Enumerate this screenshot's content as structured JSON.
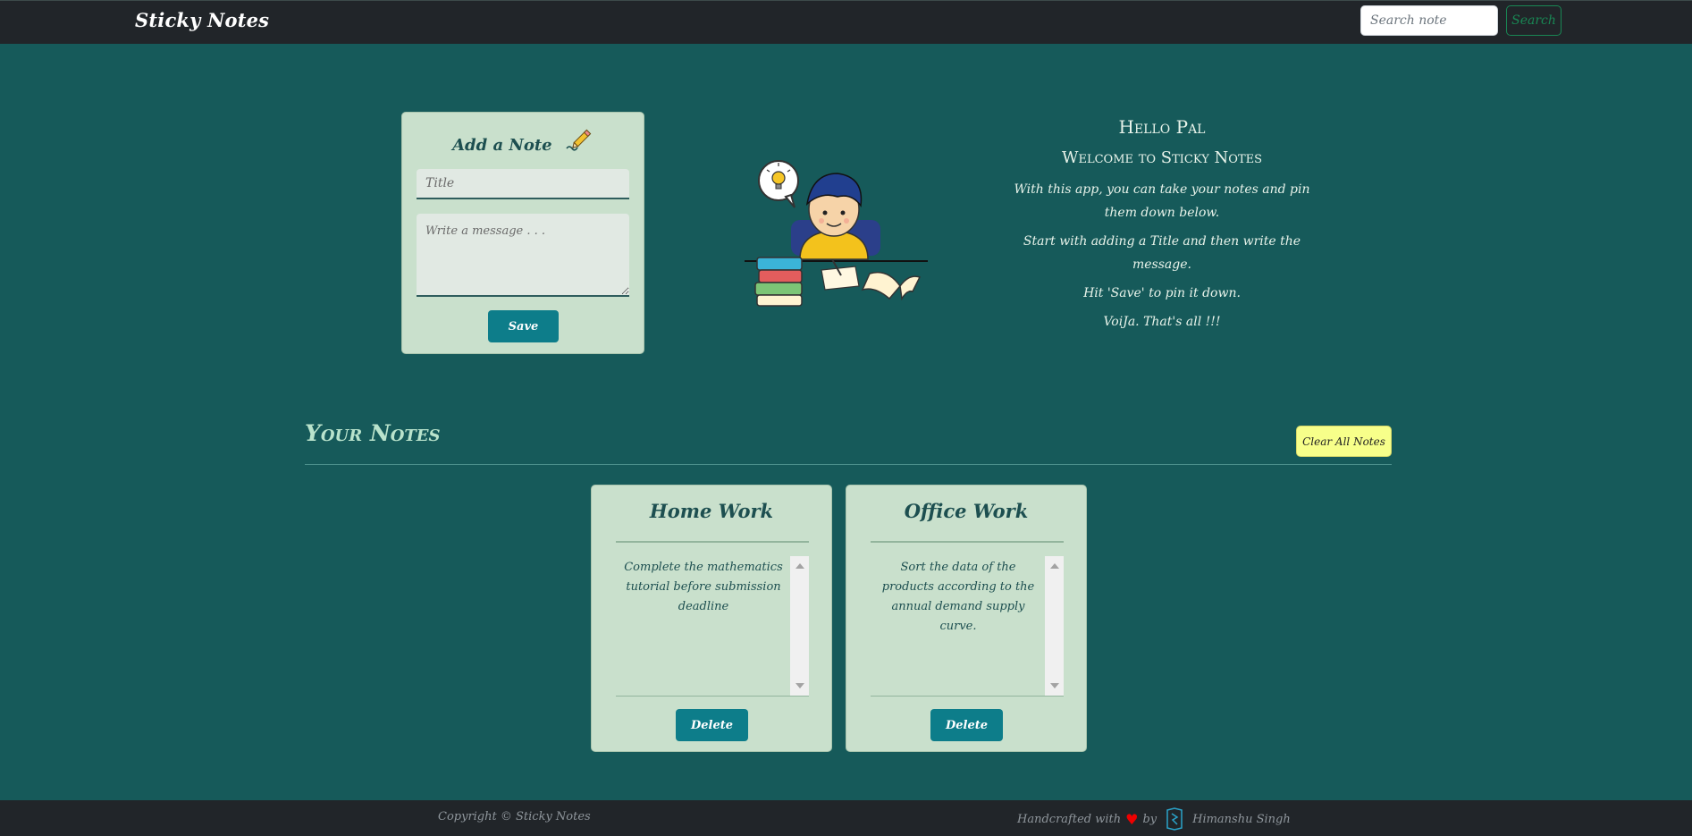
{
  "navbar": {
    "brand": "Sticky Notes",
    "search_placeholder": "Search note",
    "search_button": "Search"
  },
  "add_note": {
    "heading": "Add a Note",
    "title_placeholder": "Title",
    "message_placeholder": "Write a message . . .",
    "save_button": "Save"
  },
  "welcome": {
    "hello": "Hello Pal",
    "subtitle": "Welcome to Sticky Notes",
    "lines": [
      "With this app, you can take your notes and pin them down below.",
      "Start with adding a Title and then write the message.",
      "Hit 'Save' to pin it down.",
      "VoiJa. That's all !!!"
    ]
  },
  "notes_section": {
    "heading": "Your Notes",
    "clear_button": "Clear All Notes",
    "notes": [
      {
        "title": "Home Work",
        "text": "Complete the mathematics tutorial before submission deadline",
        "delete_label": "Delete"
      },
      {
        "title": "Office Work",
        "text": "Sort the data of the products according to the annual demand supply curve.",
        "delete_label": "Delete"
      }
    ]
  },
  "footer": {
    "copyright": "Copyright © Sticky Notes",
    "credit_prefix": "Handcrafted with",
    "credit_by": "by",
    "author": "Himanshu Singh"
  },
  "colors": {
    "background": "#165a5a",
    "navbar": "#212529",
    "card": "#c9e0cc",
    "button": "#0d7d8a",
    "clear_button": "#f7ff8a",
    "search_button": "#198754"
  },
  "icons": [
    "pencil-icon",
    "heart-icon",
    "author-logo-icon",
    "lightbulb-icon"
  ]
}
